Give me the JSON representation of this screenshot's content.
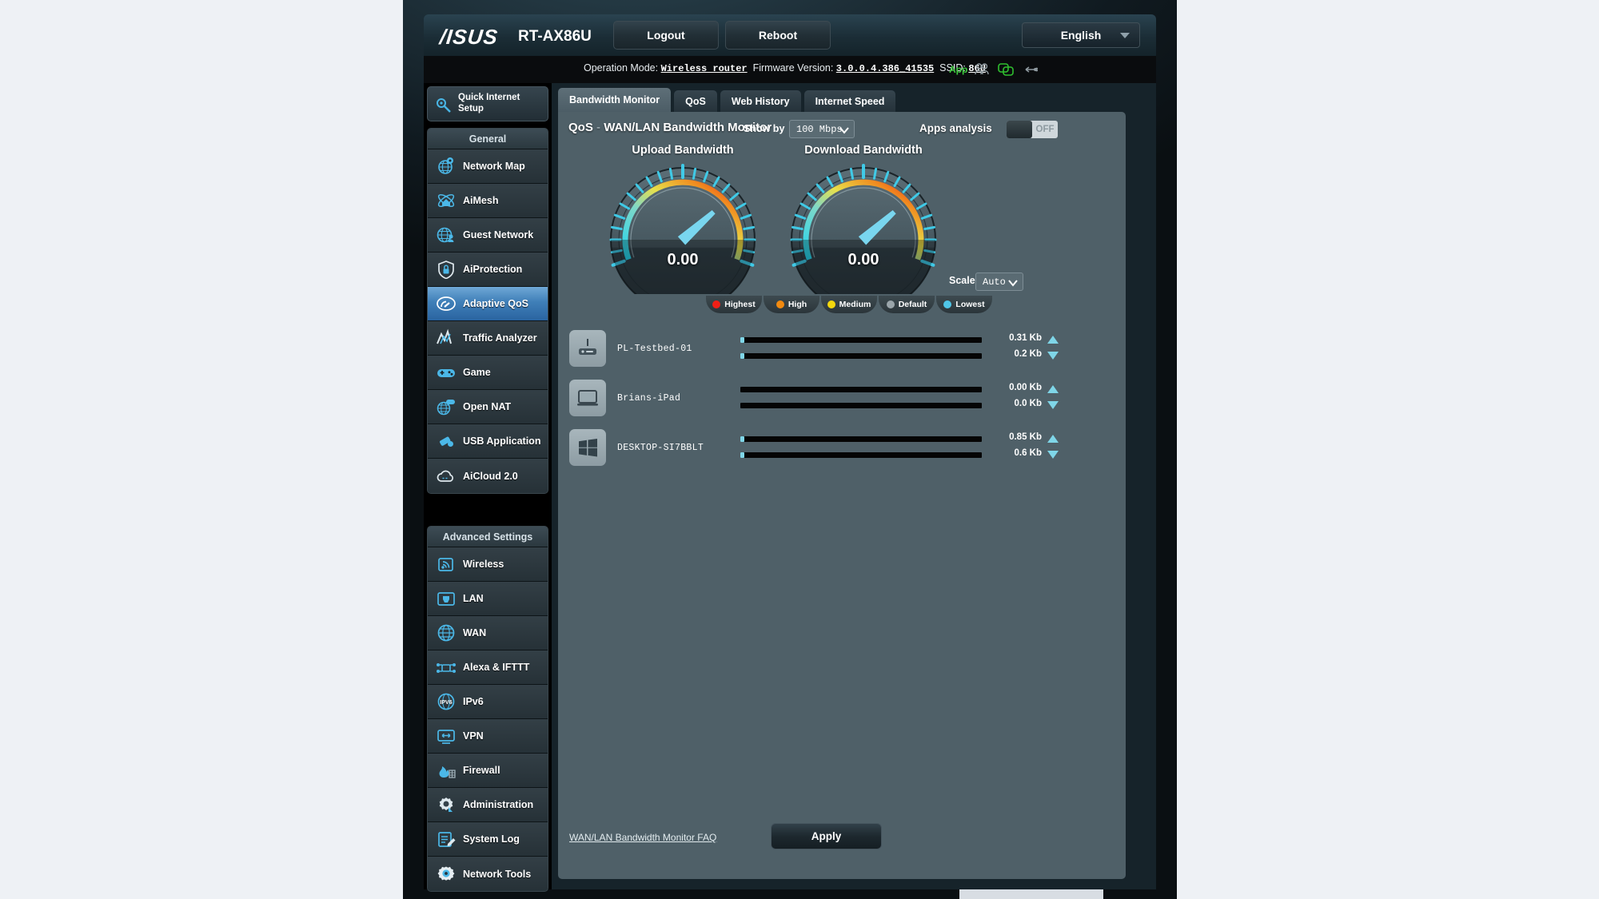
{
  "header": {
    "brand": "/ISUS",
    "model": "RT-AX86U",
    "logout_label": "Logout",
    "reboot_label": "Reboot",
    "language": "English"
  },
  "info": {
    "operation_mode_label": "Operation Mode:",
    "operation_mode_value": "Wireless router",
    "firmware_label": "Firmware Version:",
    "firmware_value": "3.0.0.4.386_41535",
    "ssid_label": "SSID:",
    "ssid_value": "86U",
    "app_label": "App"
  },
  "sidebar": {
    "quick_internet_setup": "Quick Internet Setup",
    "general_title": "General",
    "general_items": [
      {
        "label": "Network Map",
        "icon": "network-map-icon",
        "active": false
      },
      {
        "label": "AiMesh",
        "icon": "aimesh-icon",
        "active": false
      },
      {
        "label": "Guest Network",
        "icon": "guest-network-icon",
        "active": false
      },
      {
        "label": "AiProtection",
        "icon": "aiprotection-icon",
        "active": false
      },
      {
        "label": "Adaptive QoS",
        "icon": "adaptive-qos-icon",
        "active": true
      },
      {
        "label": "Traffic Analyzer",
        "icon": "traffic-analyzer-icon",
        "active": false
      },
      {
        "label": "Game",
        "icon": "game-icon",
        "active": false
      },
      {
        "label": "Open NAT",
        "icon": "open-nat-icon",
        "active": false
      },
      {
        "label": "USB Application",
        "icon": "usb-application-icon",
        "active": false
      },
      {
        "label": "AiCloud 2.0",
        "icon": "aicloud-icon",
        "active": false
      }
    ],
    "advanced_title": "Advanced Settings",
    "advanced_items": [
      {
        "label": "Wireless",
        "icon": "wireless-icon"
      },
      {
        "label": "LAN",
        "icon": "lan-icon"
      },
      {
        "label": "WAN",
        "icon": "wan-icon"
      },
      {
        "label": "Alexa & IFTTT",
        "icon": "alexa-ifttt-icon"
      },
      {
        "label": "IPv6",
        "icon": "ipv6-icon"
      },
      {
        "label": "VPN",
        "icon": "vpn-icon"
      },
      {
        "label": "Firewall",
        "icon": "firewall-icon"
      },
      {
        "label": "Administration",
        "icon": "administration-icon"
      },
      {
        "label": "System Log",
        "icon": "system-log-icon"
      },
      {
        "label": "Network Tools",
        "icon": "network-tools-icon"
      }
    ]
  },
  "tabs": [
    {
      "label": "Bandwidth Monitor",
      "active": true
    },
    {
      "label": "QoS",
      "active": false
    },
    {
      "label": "Web History",
      "active": false
    },
    {
      "label": "Internet Speed",
      "active": false
    }
  ],
  "panel": {
    "title_main": "QoS",
    "title_dash": " - ",
    "title_sub": "WAN/LAN Bandwidth Monitor",
    "show_by_label": "Show by",
    "show_by_value": "100 Mbps",
    "apps_analysis_label": "Apps analysis",
    "apps_analysis_state": "OFF",
    "scale_label": "Scale",
    "scale_value": "Auto",
    "faq_link": "WAN/LAN Bandwidth Monitor FAQ",
    "apply_label": "Apply"
  },
  "gauges": [
    {
      "title": "Upload Bandwidth",
      "value": "0.00",
      "needle_deg": -42
    },
    {
      "title": "Download Bandwidth",
      "value": "0.00",
      "needle_deg": -42
    }
  ],
  "legend": [
    {
      "label": "Highest",
      "color": "#f01f16"
    },
    {
      "label": "High",
      "color": "#f28a10"
    },
    {
      "label": "Medium",
      "color": "#f5d80d"
    },
    {
      "label": "Default",
      "color": "#9aa5aa"
    },
    {
      "label": "Lowest",
      "color": "#4fc6e8"
    }
  ],
  "devices": [
    {
      "name": "PL-Testbed-01",
      "icon": "router-icon",
      "upload": "0.31 Kb",
      "download": "0.2 Kb",
      "upload_pct": 1.5,
      "download_pct": 1.5
    },
    {
      "name": "Brians-iPad",
      "icon": "laptop-icon",
      "upload": "0.00 Kb",
      "download": "0.0 Kb",
      "upload_pct": 0,
      "download_pct": 0
    },
    {
      "name": "DESKTOP-SI7BBLT",
      "icon": "windows-icon",
      "upload": "0.85 Kb",
      "download": "0.6 Kb",
      "upload_pct": 1.5,
      "download_pct": 1.5
    }
  ],
  "colors": {
    "accent": "#4fc6e8",
    "panel_bg": "#4f6068",
    "active_nav": "#3f7fb8"
  }
}
